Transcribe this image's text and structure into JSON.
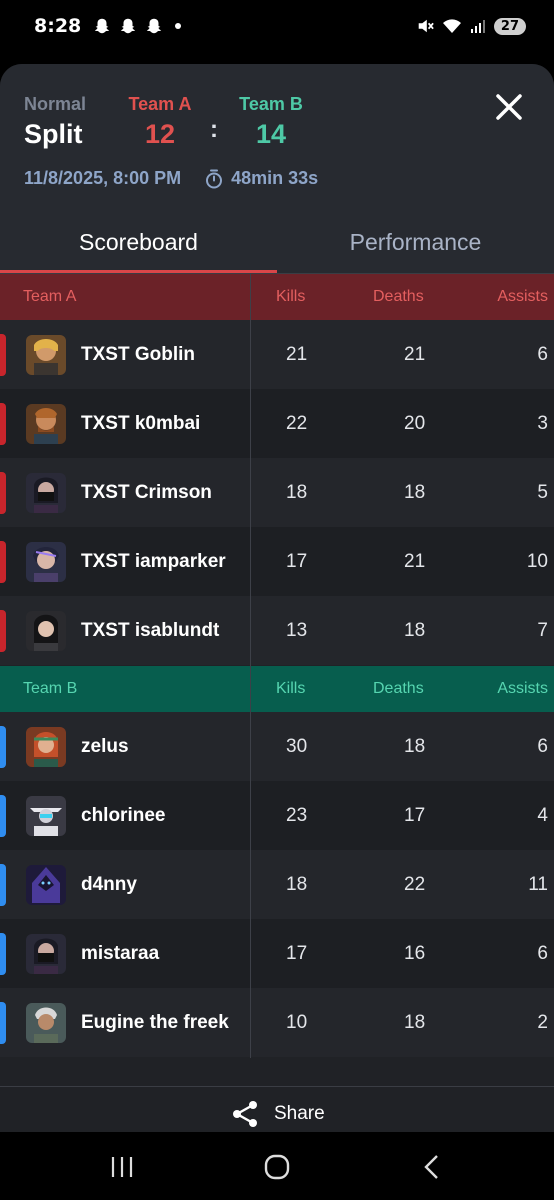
{
  "status_bar": {
    "time": "8:28",
    "battery": "27"
  },
  "match": {
    "mode": "Normal",
    "map": "Split",
    "team_a_label": "Team A",
    "team_a_score": "12",
    "team_b_label": "Team B",
    "team_b_score": "14",
    "separator": ":",
    "datetime": "11/8/2025, 8:00 PM",
    "duration": "48min 33s"
  },
  "tabs": [
    "Scoreboard",
    "Performance"
  ],
  "columns": {
    "kills": "Kills",
    "deaths": "Deaths",
    "assists": "Assists"
  },
  "team_a": {
    "label": "Team A",
    "players": [
      {
        "name": "TXST Goblin",
        "kills": "21",
        "deaths": "21",
        "assists": "6"
      },
      {
        "name": "TXST k0mbai",
        "kills": "22",
        "deaths": "20",
        "assists": "3"
      },
      {
        "name": "TXST Crimson",
        "kills": "18",
        "deaths": "18",
        "assists": "5"
      },
      {
        "name": "TXST iamparker",
        "kills": "17",
        "deaths": "21",
        "assists": "10"
      },
      {
        "name": "TXST isablundt",
        "kills": "13",
        "deaths": "18",
        "assists": "7"
      }
    ]
  },
  "team_b": {
    "label": "Team B",
    "players": [
      {
        "name": "zelus",
        "kills": "30",
        "deaths": "18",
        "assists": "6"
      },
      {
        "name": "chlorinee",
        "kills": "23",
        "deaths": "17",
        "assists": "4"
      },
      {
        "name": "d4nny",
        "kills": "18",
        "deaths": "22",
        "assists": "11"
      },
      {
        "name": "mistaraa",
        "kills": "17",
        "deaths": "16",
        "assists": "6"
      },
      {
        "name": "Eugine the freek",
        "kills": "10",
        "deaths": "18",
        "assists": "2"
      }
    ]
  },
  "share": {
    "label": "Share"
  },
  "colors": {
    "team_a": "#e0514f",
    "team_b": "#4ec9a6",
    "team_a_bar": "#c8252c",
    "team_b_bar": "#2f8df0"
  },
  "icons": [
    "snapchat-ghost-icon",
    "mute-icon",
    "wifi-icon",
    "signal-icon",
    "close-icon",
    "stopwatch-icon",
    "share-icon",
    "recent-apps-icon",
    "home-icon",
    "back-icon"
  ]
}
